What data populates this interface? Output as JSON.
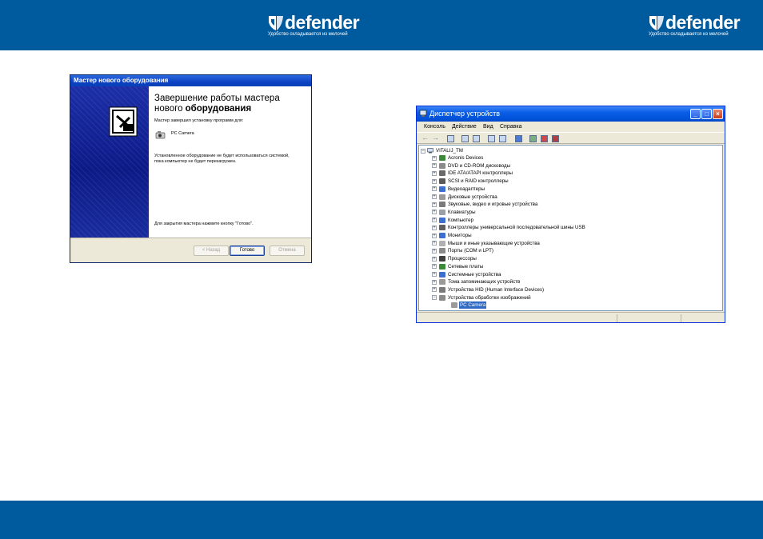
{
  "brand": {
    "name": "defender",
    "tagline": "Удобство складывается из мелочей"
  },
  "wizard": {
    "title": "Мастер нового оборудования",
    "heading_line1": "Завершение работы мастера",
    "heading_line2_prefix": "нового ",
    "heading_line2_bold": "оборудования",
    "installed_text": "Мастер завершил установку программ для:",
    "device_name": "PC Camera",
    "note": "Установленное оборудование не будет использоваться системой, пока компьютер не будет перезагружен.",
    "close_hint": "Для закрытия мастера нажмите кнопку \"Готово\".",
    "buttons": {
      "back": "< Назад",
      "finish": "Готово",
      "cancel": "Отмена"
    }
  },
  "device_manager": {
    "title": "Диспетчер устройств",
    "menu": [
      "Консоль",
      "Действие",
      "Вид",
      "Справка"
    ],
    "tree": {
      "root": "VITALIJ_TM",
      "items": [
        {
          "label": "Acronis Devices",
          "color": "#3a8a3a"
        },
        {
          "label": "DVD и CD-ROM дисководы",
          "color": "#8a8a8a"
        },
        {
          "label": "IDE ATA/ATAPI контроллеры",
          "color": "#6a6a6a"
        },
        {
          "label": "SCSI и RAID контроллеры",
          "color": "#5a5a5a"
        },
        {
          "label": "Видеоадаптеры",
          "color": "#3c6fd0"
        },
        {
          "label": "Дисковые устройства",
          "color": "#9a9a9a"
        },
        {
          "label": "Звуковые, видео и игровые устройства",
          "color": "#7a7a7a"
        },
        {
          "label": "Клавиатуры",
          "color": "#9aa0a8"
        },
        {
          "label": "Компьютер",
          "color": "#3c6fd0"
        },
        {
          "label": "Контроллеры универсальной последовательной шины USB",
          "color": "#606060"
        },
        {
          "label": "Мониторы",
          "color": "#3c6fd0"
        },
        {
          "label": "Мыши и иные указывающие устройства",
          "color": "#b0b0b0"
        },
        {
          "label": "Порты (COM и LPT)",
          "color": "#8a8a8a"
        },
        {
          "label": "Процессоры",
          "color": "#404040"
        },
        {
          "label": "Сетевые платы",
          "color": "#3a8a3a"
        },
        {
          "label": "Системные устройства",
          "color": "#3c6fd0"
        },
        {
          "label": "Тома запоминающих устройств",
          "color": "#9a9a9a"
        },
        {
          "label": "Устройства HID (Human Interface Devices)",
          "color": "#7a7a7a"
        },
        {
          "label": "Устройства обработки изображений",
          "color": "#8a8a8a"
        }
      ],
      "child": "PC Camera"
    }
  }
}
